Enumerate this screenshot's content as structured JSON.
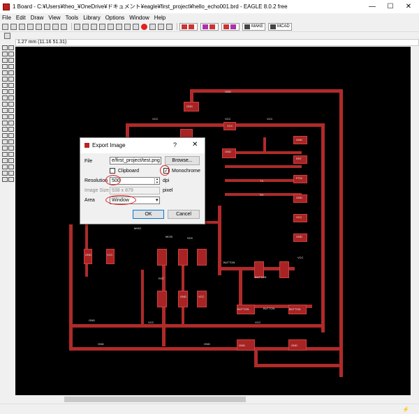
{
  "titlebar": {
    "title": "1 Board - C:¥Users¥theo_¥OneDrive¥ドキュメント¥eagle¥first_project¥hello_echo001.brd - EAGLE 8.0.2 free",
    "minimize": "—",
    "maximize": "☐",
    "close": "✕"
  },
  "menu": {
    "items": [
      "File",
      "Edit",
      "Draw",
      "View",
      "Tools",
      "Library",
      "Options",
      "Window",
      "Help"
    ]
  },
  "toolbar": {
    "make_label": "MAKE",
    "mcad_label": "MCAD"
  },
  "coord": {
    "readout": "1.27 mm (11.16 51.31)"
  },
  "board": {
    "labels": [
      "GND",
      "VCC",
      "VCC",
      "VCC",
      "VCC",
      "GND",
      "GND",
      "GND",
      "GND",
      "GND",
      "BUTTON",
      "BUTTON",
      "BUTTON",
      "BUTTON",
      "BUTTON",
      "GND",
      "VCC",
      "GND",
      "GND",
      "VCC",
      "MISO",
      "MOSI",
      "SCK",
      "RST",
      "VCC",
      "TX",
      "RX",
      "RST",
      "FTDI",
      "GND",
      "VCC",
      "GND",
      "GND",
      "VCC",
      "VCC",
      "GND"
    ]
  },
  "dialog": {
    "title": "Export Image",
    "help": "?",
    "close": "✕",
    "file_label": "File",
    "file_value": "e/first_project/test.png",
    "browse_label": "Browse...",
    "clipboard_label": "Clipboard",
    "clipboard_checked": false,
    "monochrome_label": "Monochrome",
    "monochrome_checked": true,
    "check_glyph": "✓",
    "resolution_label": "Resolution",
    "resolution_value": "500",
    "resolution_unit": "dpi",
    "image_size_label": "Image Size",
    "image_size_value": "938 x 879",
    "image_size_unit": "pixel",
    "area_label": "Area",
    "area_value": "Window",
    "ok_label": "OK",
    "cancel_label": "Cancel"
  },
  "status": {
    "icon": "⚡"
  }
}
